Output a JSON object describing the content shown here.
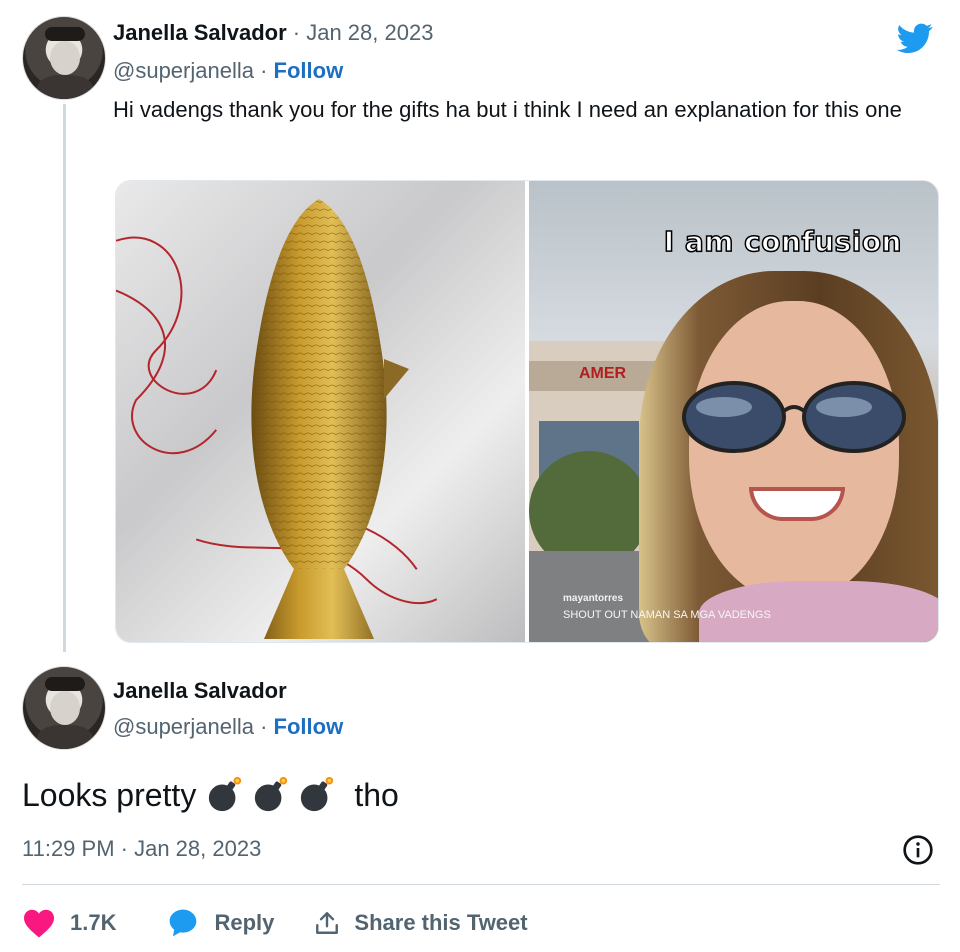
{
  "tweet1": {
    "author": "Janella Salvador",
    "date": "Jan 28, 2023",
    "separator": " · ",
    "handle": "@superjanella",
    "follow_label": "Follow",
    "text": "Hi vadengs thank you for the gifts ha but i think I need an explanation for this one",
    "media_caption": "I am confusion",
    "media_watermark_user": "mayantorres",
    "media_watermark_text": "SHOUT OUT NAMAN SA MGA VADENGS",
    "media_sign": "AMER"
  },
  "tweet2": {
    "author": "Janella Salvador",
    "handle": "@superjanella",
    "separator": " · ",
    "follow_label": "Follow",
    "text_before": "Looks pretty",
    "emoji": [
      "bomb-icon",
      "bomb-icon",
      "bomb-icon"
    ],
    "text_after": "tho",
    "timestamp": "11:29 PM · Jan 28, 2023"
  },
  "actions": {
    "likes": "1.7K",
    "reply_label": "Reply",
    "share_label": "Share this Tweet"
  },
  "colors": {
    "follow_blue": "#1d6fc2",
    "twitter_blue": "#1d9bf0",
    "like_pink": "#f91880",
    "text_gray": "#536471"
  },
  "icons": [
    "twitter-bird-icon",
    "info-icon",
    "heart-icon",
    "reply-icon",
    "share-icon"
  ]
}
